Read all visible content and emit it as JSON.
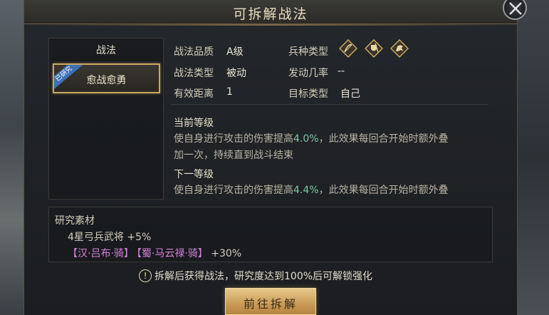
{
  "dialog": {
    "title": "可拆解战法"
  },
  "left": {
    "header": "战法",
    "skill_name": "愈战愈勇",
    "badge": "已研究"
  },
  "info": {
    "quality_label": "战法品质",
    "quality_value": "A级",
    "type_label": "战法类型",
    "type_value": "被动",
    "range_label": "有效距离",
    "range_value": "1",
    "troop_label": "兵种类型",
    "troop_icons": [
      "bow-troop-icon",
      "shield-troop-icon",
      "cavalry-troop-icon"
    ],
    "chance_label": "发动几率",
    "chance_value": "--",
    "target_label": "目标类型",
    "target_value": "自己"
  },
  "levels": {
    "current_title": "当前等级",
    "current_desc_a": "使自身进行攻击的伤害提高",
    "current_value": "4.0%",
    "current_desc_b": "，此效果每回合开始时额外叠",
    "current_desc_c": "加一次，持续直到战斗结束",
    "next_title": "下一等级",
    "next_desc_a": "使自身进行攻击的伤害提高",
    "next_value": "4.4%",
    "next_desc_b": "，此效果每回合开始时额外叠"
  },
  "materials": {
    "title": "研究素材",
    "line1": "4星弓兵武将 +5%",
    "hero1": "【汉·吕布·骑】",
    "hero2": "【蜀·马云禄·骑】",
    "line2_bonus": " +30%"
  },
  "hint": {
    "icon": "!",
    "text": "拆解后获得战法，研究度达到100%后可解锁强化"
  },
  "button": {
    "go_label": "前往拆解"
  },
  "colors": {
    "highlight": "#7fc6a3",
    "hero_name": "#d583d9",
    "gold": "#c99b57"
  }
}
